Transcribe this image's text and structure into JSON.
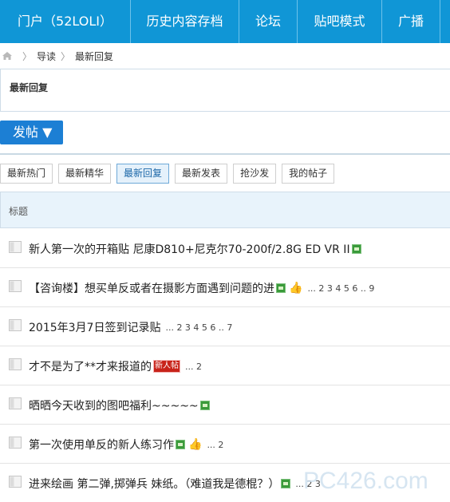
{
  "topnav": {
    "items": [
      "门户（52LOLI）",
      "历史内容存档",
      "论坛",
      "贴吧模式",
      "广播"
    ]
  },
  "breadcrumb": {
    "items": [
      "导读",
      "最新回复"
    ]
  },
  "header": {
    "title": "最新回复"
  },
  "post_button": {
    "label": "发帖",
    "arrow": "▼"
  },
  "tabs": [
    {
      "label": "最新热门",
      "active": false
    },
    {
      "label": "最新精华",
      "active": false
    },
    {
      "label": "最新回复",
      "active": true
    },
    {
      "label": "最新发表",
      "active": false
    },
    {
      "label": "抢沙发",
      "active": false
    },
    {
      "label": "我的帖子",
      "active": false
    }
  ],
  "table": {
    "header": "标题",
    "rows": [
      {
        "title": "新人第一次的开箱贴 尼康D810+尼克尔70-200f/2.8G ED VR II",
        "image": true,
        "thumb": false,
        "badge": "",
        "pages": ""
      },
      {
        "title": "【咨询楼】想买单反或者在摄影方面遇到问题的进",
        "image": true,
        "thumb": true,
        "badge": "",
        "pages": "... 2  3  4  5  6 .. 9"
      },
      {
        "title": "2015年3月7日签到记录贴",
        "image": false,
        "thumb": false,
        "badge": "",
        "pages": "... 2  3  4  5  6 .. 7"
      },
      {
        "title": "才不是为了**才来报道的",
        "image": false,
        "thumb": false,
        "badge": "新人帖",
        "pages": "... 2"
      },
      {
        "title": "晒晒今天收到的图吧福利~~~~~",
        "image": true,
        "thumb": false,
        "badge": "",
        "pages": ""
      },
      {
        "title": "第一次使用单反的新人练习作",
        "image": true,
        "thumb": true,
        "badge": "",
        "pages": "... 2"
      },
      {
        "title": "进来绘画 第二弹,掷弹兵 妹纸。（难道我是德棍？）",
        "image": true,
        "thumb": false,
        "badge": "",
        "pages": "... 2  3"
      }
    ]
  },
  "watermark": {
    "text": "PC4​26.com"
  },
  "colors": {
    "nav_bg": "#1096d6",
    "button_bg": "#1c7fd4",
    "header_bg": "#e8f3fb"
  }
}
